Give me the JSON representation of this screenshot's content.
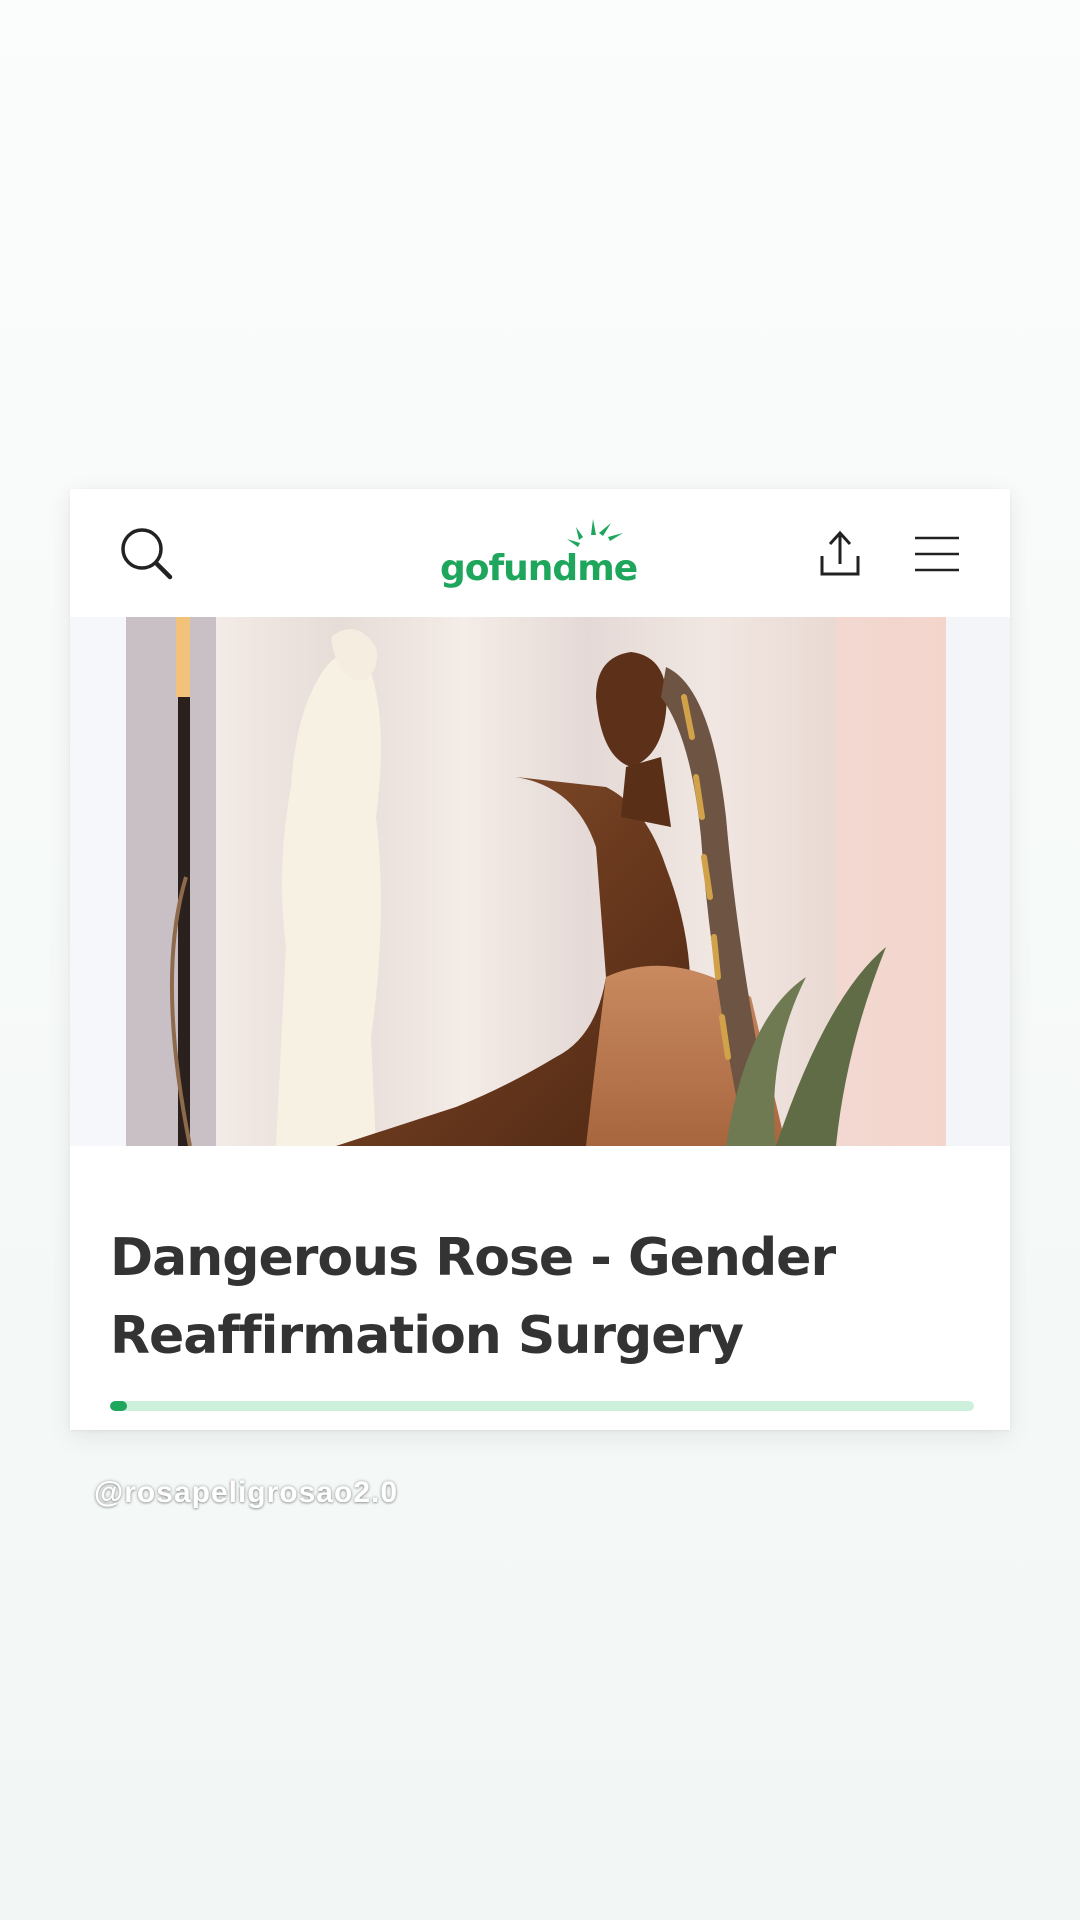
{
  "header": {
    "logo_text": "gofundme",
    "brand_color": "#1fa65d",
    "icons": [
      "search-icon",
      "share-icon",
      "menu-icon"
    ]
  },
  "campaign": {
    "title": "Dangerous Rose - Gender Reaffirmation Surgery",
    "progress_fraction": 0.02,
    "progress_track_color": "#cdf0dc",
    "progress_fill_color": "#1fa65d"
  },
  "overlay": {
    "handle": "@rosapeligrosao2.0"
  }
}
